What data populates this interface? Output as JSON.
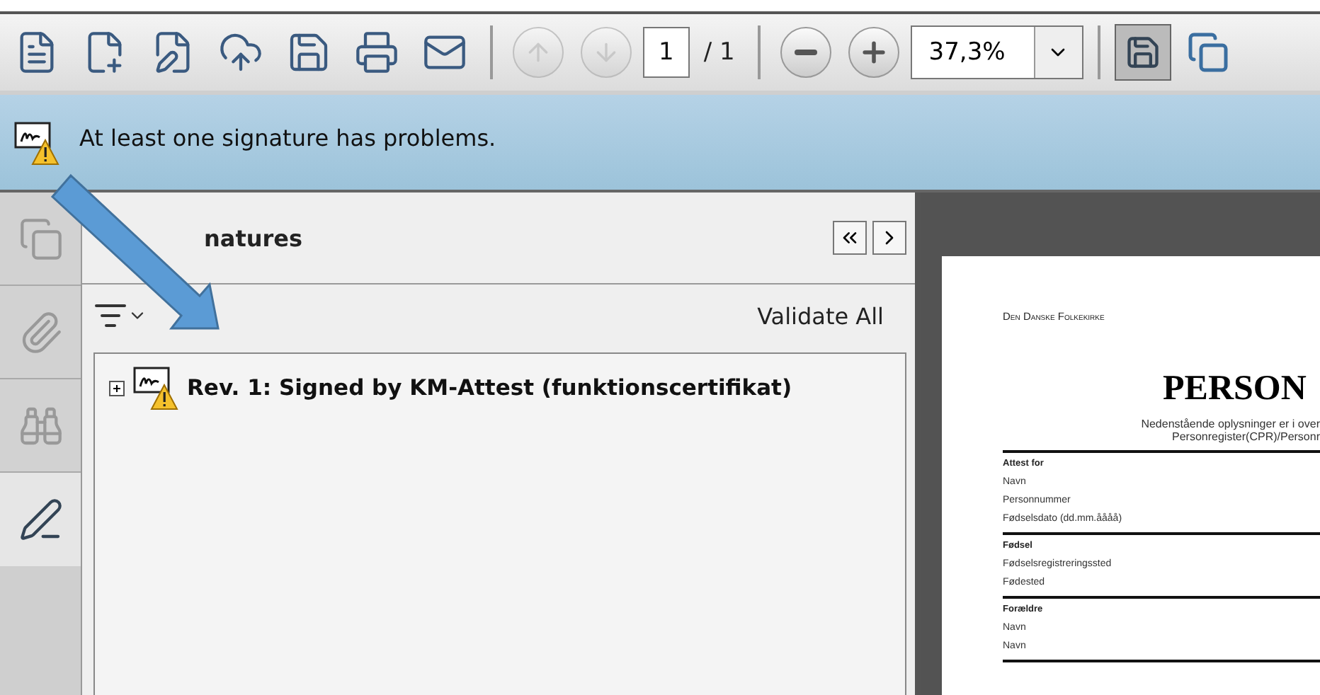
{
  "toolbar": {
    "buttons": [
      {
        "kind": "create",
        "disabled": false
      },
      {
        "kind": "combine",
        "disabled": false
      },
      {
        "kind": "edit",
        "disabled": false
      },
      {
        "kind": "upload",
        "disabled": false
      },
      {
        "kind": "save",
        "disabled": false
      },
      {
        "kind": "print",
        "disabled": false
      },
      {
        "kind": "email",
        "disabled": false
      }
    ],
    "nav": [
      {
        "kind": "up",
        "disabled": true
      },
      {
        "kind": "down",
        "disabled": true
      }
    ],
    "page_number": "1",
    "page_total": "/ 1",
    "zoom": "37,3%"
  },
  "notification": {
    "message": "At least one signature has problems."
  },
  "side_rail": [
    {
      "kind": "pages",
      "selected": false
    },
    {
      "kind": "attachments",
      "selected": false
    },
    {
      "kind": "search",
      "selected": false
    },
    {
      "kind": "signatures",
      "selected": true
    }
  ],
  "signatures_panel": {
    "title": "natures",
    "validate_all": "Validate All",
    "items": [
      {
        "label": "Rev. 1: Signed by KM-Attest (funktionscertifikat)",
        "expanded": false
      }
    ]
  },
  "document": {
    "header": "Den Danske Folkekirke",
    "title": "PERSON",
    "subtitle": [
      "Nedenstående oplysninger er i over",
      "Personregister(CPR)/Personr"
    ],
    "sections": [
      {
        "heading": "Attest for",
        "fields": [
          "Navn",
          "Personnummer",
          "Fødselsdato (dd.mm.åååå)"
        ]
      },
      {
        "heading": "Fødsel",
        "fields": [
          "Fødselsregistreringssted",
          "Fødested"
        ]
      },
      {
        "heading": "Forældre",
        "fields": [
          "Navn",
          "Navn"
        ]
      }
    ]
  }
}
